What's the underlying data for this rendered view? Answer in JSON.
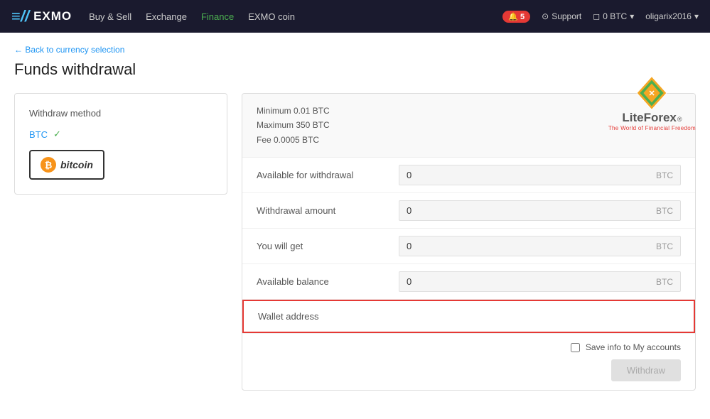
{
  "navbar": {
    "logo_icon": "≡//",
    "logo_text": "EXMO",
    "links": [
      {
        "label": "Buy & Sell",
        "active": false
      },
      {
        "label": "Exchange",
        "active": false
      },
      {
        "label": "Finance",
        "active": true
      },
      {
        "label": "EXMO coin",
        "active": false
      }
    ],
    "notification_count": "5",
    "support_label": "Support",
    "wallet_label": "0 BTC",
    "user_label": "oligarix2016"
  },
  "back_link": "← Back to currency selection",
  "page_title": "Funds withdrawal",
  "partner": {
    "name": "LiteForex",
    "superscript": "®",
    "tagline": "The World of Financial Freedom"
  },
  "left_panel": {
    "method_label": "Withdraw method",
    "selected_method": "BTC",
    "bitcoin_label": "bitcoin"
  },
  "right_panel": {
    "info": {
      "minimum": "Minimum 0.01 BTC",
      "maximum": "Maximum 350 BTC",
      "fee": "Fee 0.0005 BTC"
    },
    "fields": [
      {
        "label": "Available for withdrawal",
        "value": "0",
        "unit": "BTC"
      },
      {
        "label": "Withdrawal amount",
        "value": "0",
        "unit": "BTC"
      },
      {
        "label": "You will get",
        "value": "0",
        "unit": "BTC"
      },
      {
        "label": "Available balance",
        "value": "0",
        "unit": "BTC"
      }
    ],
    "wallet_address_label": "Wallet address",
    "wallet_address_placeholder": "",
    "save_label": "Save info to My accounts",
    "withdraw_button": "Withdraw"
  }
}
